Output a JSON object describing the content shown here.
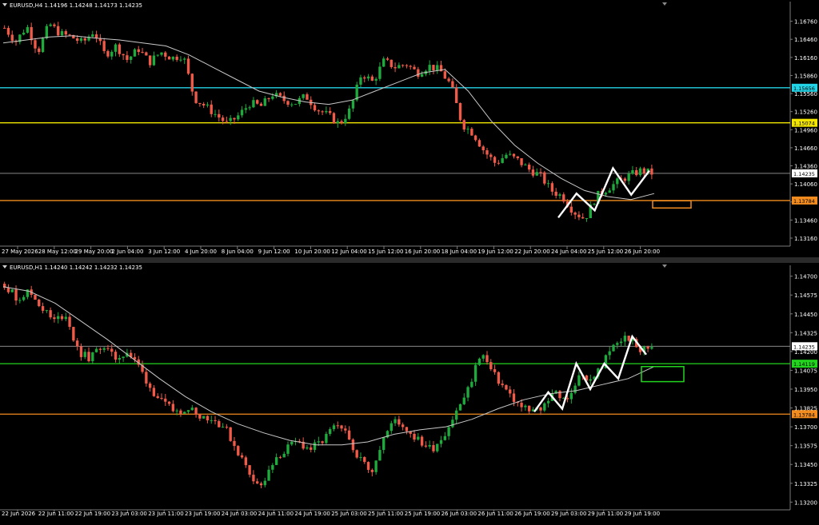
{
  "colors": {
    "background": "#000000",
    "bull": "#1faa3d",
    "bear": "#f05a48",
    "ma": "#c8c8c8",
    "frame": "#7a7a7a",
    "text": "#ffffff",
    "cyan": "#22d3e6",
    "yellow": "#f2e600",
    "orange": "#f28c1e",
    "green": "#23d41f",
    "white": "#ffffff"
  },
  "chart_data": [
    {
      "type": "candlestick",
      "name": "EURUSD H4 panel",
      "header": "EURUSD,H4  1.14196 1.14248 1.14173 1.14235",
      "y_ticks": [
        "1.16760",
        "1.16460",
        "1.16160",
        "1.15860",
        "1.15560",
        "1.15260",
        "1.14960",
        "1.14660",
        "1.14360",
        "1.14060",
        "1.13760",
        "1.13460",
        "1.13160"
      ],
      "x_ticks": [
        "27 May 2026",
        "28 May 12:00",
        "29 May 20:00",
        "2 Jun 04:00",
        "3 Jun 12:00",
        "4 Jun 20:00",
        "8 Jun 04:00",
        "9 Jun 12:00",
        "10 Jun 20:00",
        "12 Jun 04:00",
        "15 Jun 12:00",
        "16 Jun 20:00",
        "18 Jun 04:00",
        "19 Jun 12:00",
        "22 Jun 20:00",
        "24 Jun 04:00",
        "25 Jun 12:00",
        "26 Jun 20:00"
      ],
      "ylim": [
        1.1308,
        1.1698
      ],
      "levels": [
        {
          "label": "1.15656",
          "value": 1.15656,
          "color": "cyan"
        },
        {
          "label": "1.15074",
          "value": 1.15074,
          "color": "yellow"
        },
        {
          "label": "1.14235",
          "value": 1.14235,
          "color": "grey"
        },
        {
          "label": "1.13784",
          "value": 1.13784,
          "color": "orange"
        }
      ],
      "price_path": [
        1.1665,
        1.1642,
        1.1668,
        1.1625,
        1.1672,
        1.1655,
        1.165,
        1.164,
        1.166,
        1.162,
        1.1635,
        1.1612,
        1.163,
        1.1608,
        1.1625,
        1.1615,
        1.162,
        1.1548,
        1.1535,
        1.152,
        1.1505,
        1.152,
        1.154,
        1.1535,
        1.1555,
        1.1545,
        1.154,
        1.1552,
        1.153,
        1.152,
        1.1505,
        1.153,
        1.159,
        1.1575,
        1.161,
        1.16,
        1.1605,
        1.159,
        1.1602,
        1.1595,
        1.157,
        1.1505,
        1.149,
        1.146,
        1.144,
        1.1455,
        1.1445,
        1.143,
        1.142,
        1.1395,
        1.1385,
        1.136,
        1.1348,
        1.1385,
        1.1398,
        1.141,
        1.142,
        1.1428,
        1.1424
      ],
      "moving_average": [
        1.164,
        1.1645,
        1.165,
        1.1652,
        1.1648,
        1.1645,
        1.164,
        1.1635,
        1.162,
        1.16,
        1.158,
        1.156,
        1.155,
        1.1542,
        1.1538,
        1.1545,
        1.156,
        1.1575,
        1.159,
        1.1596,
        1.156,
        1.151,
        1.147,
        1.144,
        1.1415,
        1.1395,
        1.1385,
        1.138,
        1.139
      ],
      "zigzag": [
        1.135,
        1.139,
        1.1362,
        1.1432,
        1.1388,
        1.1428
      ],
      "box": {
        "from": 1.1378,
        "to": 1.1366,
        "color": "orange"
      }
    },
    {
      "type": "candlestick",
      "name": "EURUSD H1 panel",
      "header": "EURUSD,H1  1.14240 1.14242 1.14232 1.14235",
      "y_ticks": [
        "1.14700",
        "1.14575",
        "1.14450",
        "1.14325",
        "1.14200",
        "1.14075",
        "1.13950",
        "1.13825",
        "1.13700",
        "1.13575",
        "1.13450",
        "1.13325",
        "1.13200"
      ],
      "x_ticks": [
        "22 Jun 2026",
        "22 Jun 11:00",
        "22 Jun 19:00",
        "23 Jun 03:00",
        "23 Jun 11:00",
        "23 Jun 19:00",
        "24 Jun 03:00",
        "24 Jun 11:00",
        "24 Jun 19:00",
        "25 Jun 03:00",
        "25 Jun 11:00",
        "25 Jun 19:00",
        "26 Jun 03:00",
        "26 Jun 11:00",
        "26 Jun 19:00",
        "29 Jun 03:00",
        "29 Jun 11:00",
        "29 Jun 19:00"
      ],
      "ylim": [
        1.1317,
        1.1473
      ],
      "levels": [
        {
          "label": "1.14235",
          "value": 1.14235,
          "color": "grey"
        },
        {
          "label": "1.14119",
          "value": 1.14119,
          "color": "green"
        },
        {
          "label": "1.13784",
          "value": 1.13784,
          "color": "orange"
        }
      ],
      "price_path": [
        1.1465,
        1.1455,
        1.146,
        1.145,
        1.144,
        1.1445,
        1.142,
        1.1415,
        1.1425,
        1.1415,
        1.142,
        1.141,
        1.1395,
        1.1385,
        1.138,
        1.1383,
        1.1378,
        1.1375,
        1.137,
        1.1355,
        1.134,
        1.133,
        1.1345,
        1.1355,
        1.136,
        1.1355,
        1.136,
        1.137,
        1.1365,
        1.135,
        1.134,
        1.1362,
        1.1375,
        1.1368,
        1.136,
        1.1355,
        1.1365,
        1.138,
        1.1395,
        1.142,
        1.1405,
        1.1395,
        1.1385,
        1.138,
        1.1382,
        1.1395,
        1.1385,
        1.1405,
        1.14,
        1.1412,
        1.1425,
        1.143,
        1.142,
        1.1424
      ],
      "moving_average": [
        1.1463,
        1.146,
        1.1452,
        1.144,
        1.1428,
        1.1415,
        1.1402,
        1.139,
        1.138,
        1.1372,
        1.1366,
        1.1361,
        1.1358,
        1.1358,
        1.136,
        1.1365,
        1.1368,
        1.137,
        1.1375,
        1.1382,
        1.1388,
        1.1392,
        1.1394,
        1.1398,
        1.1402,
        1.141
      ],
      "zigzag": [
        1.138,
        1.1393,
        1.1382,
        1.1412,
        1.1395,
        1.1412,
        1.1402,
        1.143,
        1.1418
      ],
      "box": {
        "from": 1.141,
        "to": 1.14,
        "color": "green"
      }
    }
  ]
}
